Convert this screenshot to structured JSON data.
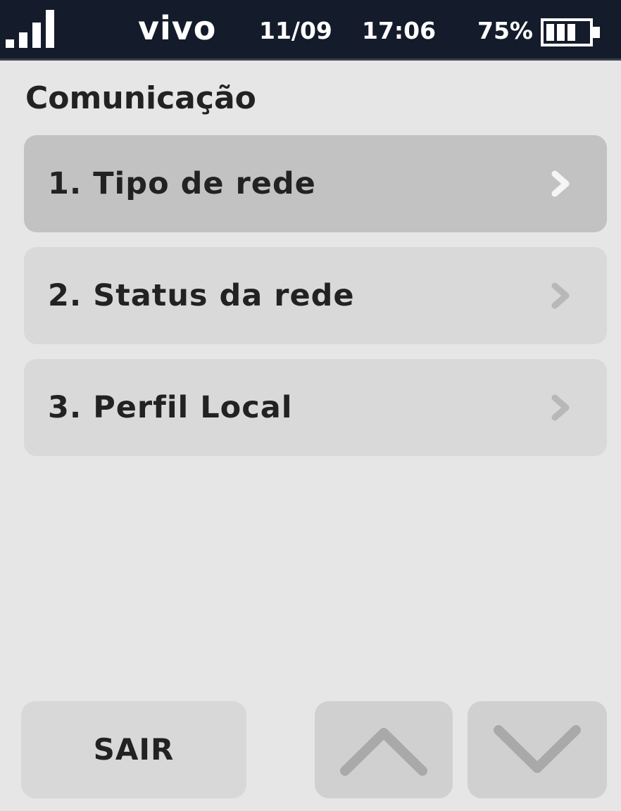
{
  "status_bar": {
    "carrier": "vivo",
    "date": "11/09",
    "time": "17:06",
    "battery_percent_label": "75%",
    "battery_level": 0.75,
    "signal_level": 4,
    "signal_icon": "signal-bars-icon",
    "battery_icon": "battery-icon"
  },
  "page": {
    "title": "Comunicação"
  },
  "menu": {
    "items": [
      {
        "label": "1. Tipo de rede",
        "selected": true
      },
      {
        "label": "2. Status da rede",
        "selected": false
      },
      {
        "label": "3. Perfil Local",
        "selected": false
      }
    ],
    "chevron_icon": "chevron-right-icon"
  },
  "footer": {
    "exit_label": "SAIR",
    "up_icon": "arrow-up-icon",
    "down_icon": "arrow-down-icon"
  },
  "colors": {
    "status_bar_bg": "#141b2b",
    "background": "#e6e6e6",
    "item_bg": "#d9d9d9",
    "item_selected_bg": "#c2c2c2",
    "text": "#222222"
  }
}
